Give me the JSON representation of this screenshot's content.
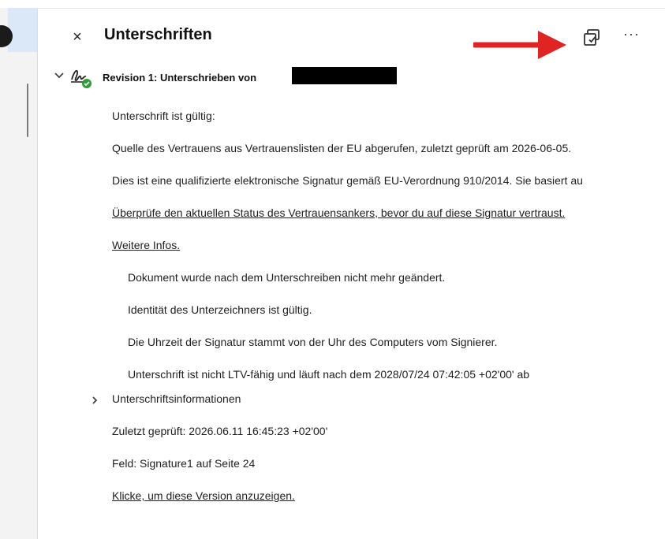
{
  "panel": {
    "close_icon": "close-icon",
    "title": "Unterschriften",
    "more_label": "···"
  },
  "revision": {
    "title": "Revision 1: Unterschrieben von"
  },
  "details": {
    "status": "Unterschrift ist gültig:",
    "trust_source": "Quelle des Vertrauens aus Vertrauenslisten der EU abgerufen, zuletzt geprüft am 2026-06-05.",
    "qualified": "Dies ist eine qualifizierte elektronische Signatur gemäß EU-Verordnung 910/2014. Sie basiert au",
    "check_link": "Überprüfe den aktuellen Status des Vertrauensankers, bevor du auf diese Signatur vertraust.",
    "more_info_link": "Weitere Infos.",
    "sub_items": [
      "Dokument wurde nach dem Unterschreiben nicht mehr geändert.",
      "Identität des Unterzeichners ist gültig.",
      "Die Uhrzeit der Signatur stammt von der Uhr des Computers vom Signierer.",
      "Unterschrift ist nicht LTV-fähig und läuft nach dem 2028/07/24 07:42:05 +02'00' ab"
    ],
    "sig_info_label": "Unterschriftsinformationen",
    "last_checked": "Zuletzt geprüft: 2026.06.11 16:45:23 +02'00'",
    "field": "Feld: Signature1 auf Seite 24",
    "view_version_link": "Klicke, um diese Version anzuzeigen."
  },
  "colors": {
    "arrow": "#e02424",
    "valid_check": "#2e9d3a"
  }
}
